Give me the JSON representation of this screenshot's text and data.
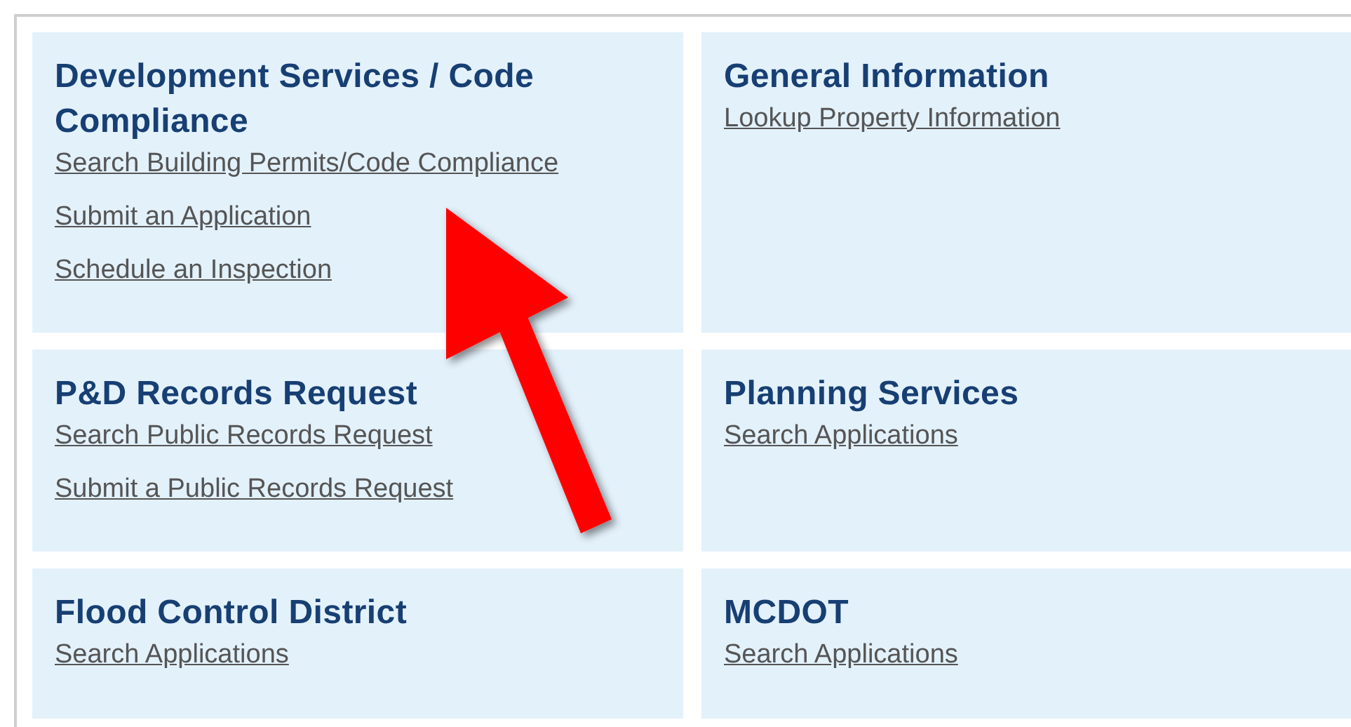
{
  "cards": [
    {
      "title": "Development Services / Code Compliance",
      "links": [
        "Search Building Permits/Code Compliance",
        "Submit an Application",
        "Schedule an Inspection"
      ]
    },
    {
      "title": "General Information",
      "links": [
        "Lookup Property Information"
      ]
    },
    {
      "title": "P&D Records Request",
      "links": [
        "Search Public Records Request",
        "Submit a Public Records Request"
      ]
    },
    {
      "title": "Planning Services",
      "links": [
        "Search Applications"
      ]
    },
    {
      "title": "Flood Control District",
      "links": [
        "Search Applications"
      ]
    },
    {
      "title": "MCDOT",
      "links": [
        "Search Applications"
      ]
    }
  ]
}
